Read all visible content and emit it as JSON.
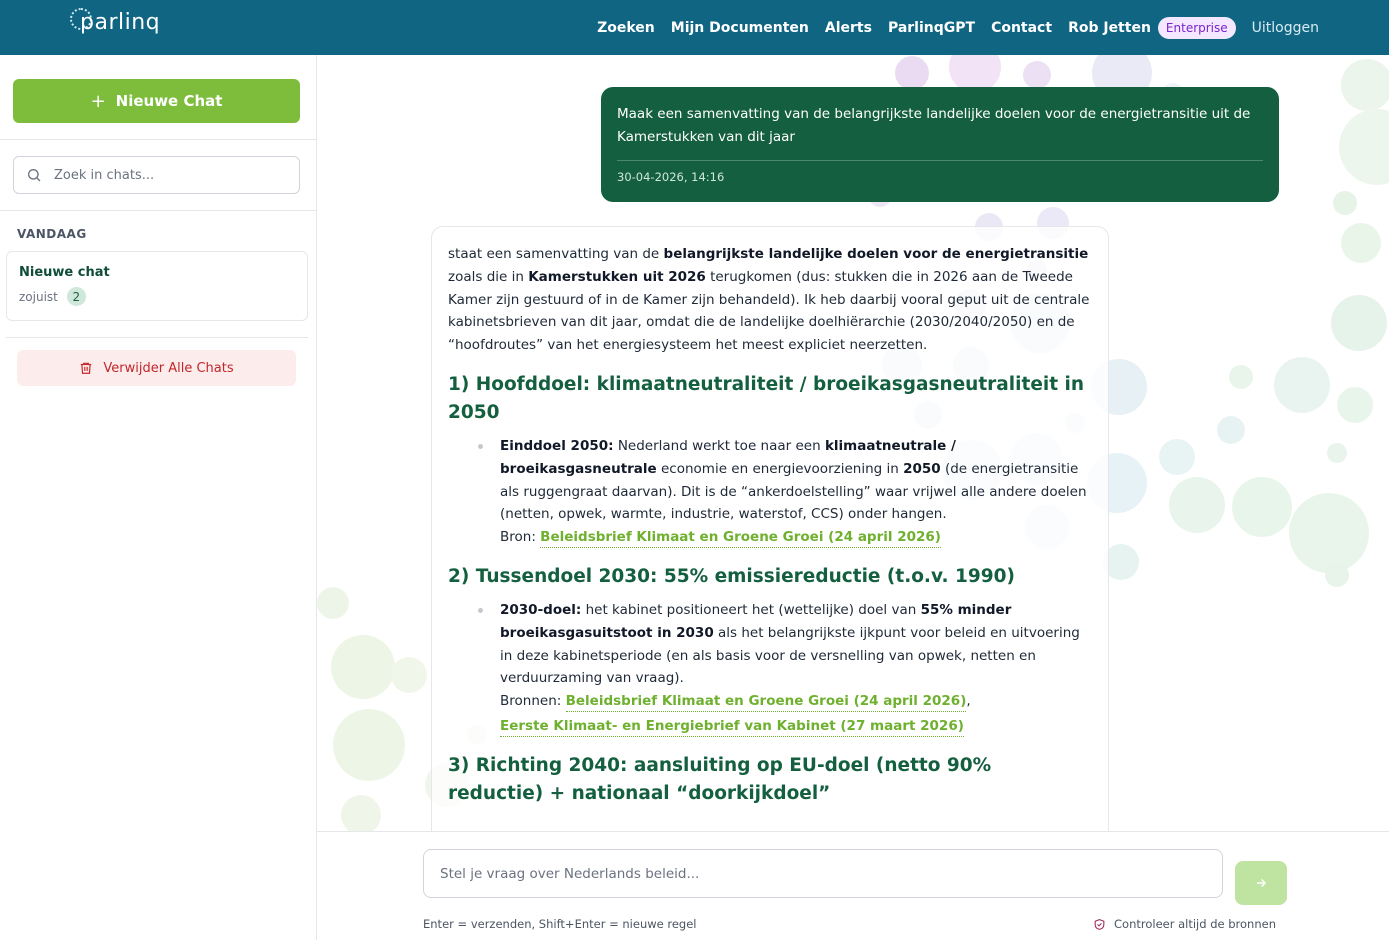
{
  "brand": {
    "logo_text": "parlinq"
  },
  "nav": {
    "items": [
      "Zoeken",
      "Mijn Documenten",
      "Alerts",
      "ParlinqGPT",
      "Contact",
      "Rob Jetten"
    ],
    "plan_badge": "Enterprise",
    "logout": "Uitloggen"
  },
  "sidebar": {
    "new_chat_label": "Nieuwe Chat",
    "search_placeholder": "Zoek in chats...",
    "group_label": "VANDAAG",
    "chat": {
      "title": "Nieuwe chat",
      "time": "zojuist",
      "count": "2"
    },
    "delete_all_label": "Verwijder Alle Chats"
  },
  "conversation": {
    "user_message": {
      "text": "Maak een samenvatting van de belangrijkste landelijke doelen voor de energietransitie uit de Kamerstukken van dit jaar",
      "timestamp": "30-04-2026, 14:16"
    },
    "answer": {
      "intro": {
        "t1": "staat een samenvatting van de ",
        "b1": "belangrijkste landelijke doelen voor de energietransitie",
        "t2": " zoals die in ",
        "b2": "Kamerstukken uit 2026",
        "t3": " terugkomen (dus: stukken die in 2026 aan de Tweede Kamer zijn gestuurd of in de Kamer zijn behandeld). Ik heb daarbij vooral geput uit de centrale kabinetsbrieven van dit jaar, omdat die de landelijke doelhiërarchie (2030/2040/2050) en de “hoofdroutes” van het energiesysteem het meest expliciet neerzetten."
      },
      "section1": {
        "heading": "1) Hoofddoel: klimaatneutraliteit / broeikasgasneutraliteit in 2050",
        "lead": "Einddoel 2050:",
        "t1": " Nederland werkt toe naar een ",
        "b1": "klimaatneutrale / broeikasgasneutrale",
        "t2": " economie en energievoorziening in ",
        "b2": "2050",
        "t3": " (de energietransitie als ruggengraat daarvan). Dit is de “ankerdoelstelling” waar vrijwel alle andere doelen (netten, opwek, warmte, industrie, waterstof, CCS) onder hangen.",
        "source_label": "Bron: ",
        "source_link": "Beleidsbrief Klimaat en Groene Groei (24 april 2026)"
      },
      "section2": {
        "heading": "2) Tussendoel 2030: 55% emissiereductie (t.o.v. 1990)",
        "lead": "2030-doel:",
        "t1": " het kabinet positioneert het (wettelijke) doel van ",
        "b1": "55% minder broeikasgasuitstoot in 2030",
        "t2": " als het belangrijkste ijkpunt voor beleid en uitvoering in deze kabinetsperiode (en als basis voor de versnelling van opwek, netten en verduurzaming van vraag).",
        "sources_label": "Bronnen: ",
        "source_link1": "Beleidsbrief Klimaat en Groene Groei (24 april 2026)",
        "comma": ",",
        "source_link2": "Eerste Klimaat- en Energiebrief van Kabinet (27 maart 2026)"
      },
      "section3": {
        "heading": "3) Richting 2040: aansluiting op EU-doel (netto 90% reductie) + nationaal “doorkijkdoel”"
      }
    }
  },
  "composer": {
    "placeholder": "Stel je vraag over Nederlands beleid...",
    "hint": "Enter = verzenden, Shift+Enter = nieuwe regel",
    "verify_note": "Controleer altijd de bronnen"
  },
  "colors": {
    "topbar": "#0f6582",
    "primary_green": "#7dbd3b",
    "user_bubble": "#135f3f",
    "heading_green": "#135f3f",
    "link_green": "#6fb02f",
    "danger": "#c2262a"
  }
}
